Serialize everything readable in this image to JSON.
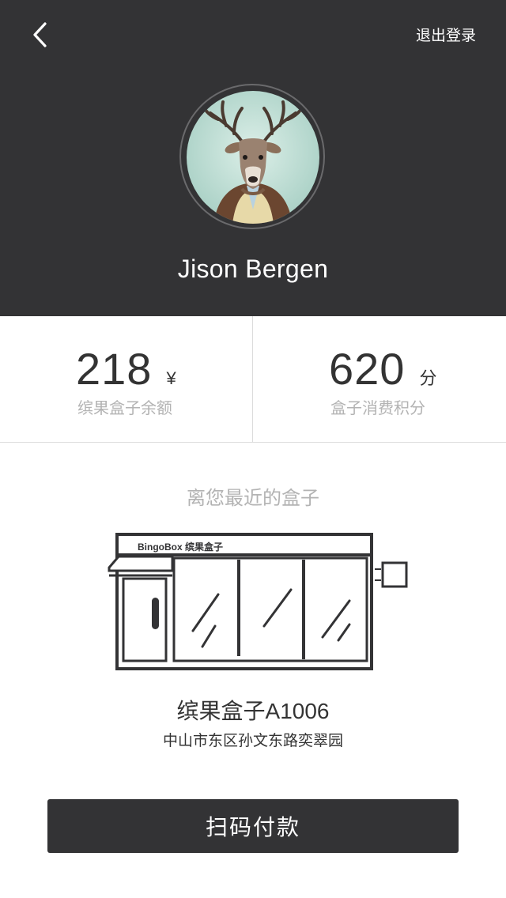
{
  "header": {
    "back_icon": "chevron-left-icon",
    "logout_label": "退出登录",
    "avatar_icon": "deer-avatar",
    "username": "Jison Bergen",
    "background_color": "#333335"
  },
  "stats": {
    "balance": {
      "value": "218",
      "unit": "¥",
      "label": "缤果盒子余额"
    },
    "points": {
      "value": "620",
      "unit": "分",
      "label": "盒子消费积分"
    }
  },
  "nearest": {
    "title": "离您最近的盒子",
    "brand_text": "BingoBox 缤果盒子",
    "box_name": "缤果盒子A1006",
    "box_address": "中山市东区孙文东路奕翠园"
  },
  "actions": {
    "pay_label": "扫码付款"
  }
}
